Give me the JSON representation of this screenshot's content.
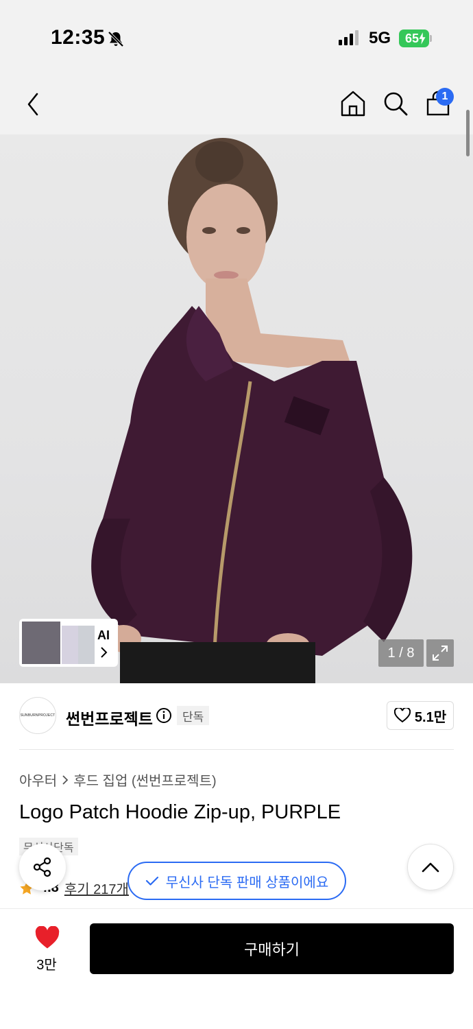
{
  "status_bar": {
    "time": "12:35",
    "network": "5G",
    "battery": "65"
  },
  "top_nav": {
    "cart_count": "1"
  },
  "gallery": {
    "ai_label": "AI",
    "page_counter": "1 / 8"
  },
  "brand": {
    "logo_text": "SUNBURNPROJECT",
    "name": "썬번프로젝트",
    "badge": "단독",
    "likes": "5.1만"
  },
  "product": {
    "breadcrumb": [
      "아우터",
      "후드 집업 (썬번프로젝트)"
    ],
    "title": "Logo Patch Hoodie Zip-up, PURPLE",
    "tag": "무신사단독",
    "rating": "4.8",
    "reviews": "후기 217개"
  },
  "toast": {
    "text": "무신사 단독 판매 상품이에요"
  },
  "bottom_bar": {
    "wish_count": "3만",
    "buy_label": "구매하기"
  },
  "colors": {
    "accent_blue": "#2b6bf3",
    "heart_red": "#e8202a",
    "battery_green": "#35c759",
    "hoodie_purple": "#3f1a33"
  }
}
